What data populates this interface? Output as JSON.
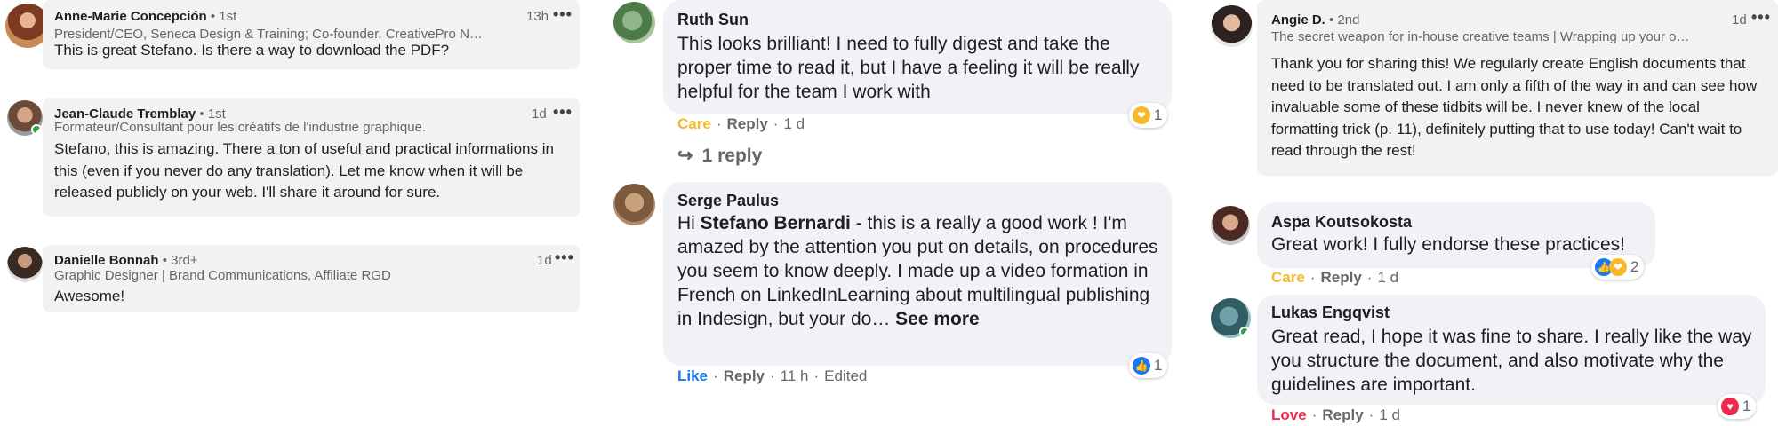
{
  "colors": {
    "linkedin_bubble": "#f2f2f2",
    "facebook_bubble": "#f0f2f5",
    "like_blue": "#1877f2",
    "care_yellow": "#f7b928",
    "love_red": "#f02849",
    "online_green": "#2e9e45"
  },
  "linkedin_comments": [
    {
      "name": "Anne-Marie Concepción",
      "degree": "• 1st",
      "headline": "President/CEO, Seneca Design & Training; Co-founder, CreativePro N…",
      "time": "13h",
      "more": "•••",
      "text": "This is great Stefano. Is there a way to download the PDF?"
    },
    {
      "name": "Jean-Claude Tremblay",
      "degree": "• 1st",
      "headline": "Formateur/Consultant pour les créatifs de l'industrie graphique.",
      "time": "1d",
      "more": "•••",
      "text": "Stefano, this is amazing. There a ton of useful and practical informations in this (even if you never do any translation). Let me know when it will be released publicly on your web. I'll share it around for sure."
    },
    {
      "name": "Danielle Bonnah",
      "degree": "• 3rd+",
      "headline": "Graphic Designer | Brand Communications, Affiliate RGD",
      "time": "1d",
      "more": "•••",
      "text": "Awesome!"
    },
    {
      "name": "Angie D.",
      "degree": "• 2nd",
      "headline": "The secret weapon for in-house creative teams | Wrapping up your o…",
      "time": "1d",
      "more": "•••",
      "text": "Thank you for sharing this! We regularly create English documents that need to be translated out. I am only a fifth of the way in and can see how invaluable some of these tidbits will be. I never knew of the local formatting trick (p. 11), definitely putting that to use today! Can't wait to read through the rest!"
    }
  ],
  "facebook_comments": [
    {
      "name": "Ruth Sun",
      "text": "This looks brilliant! I need to fully digest and take the proper time to read it, but I have a feeling it will be really helpful for the team I work with",
      "action": "Care",
      "reply": "Reply",
      "time": "1 d",
      "reactions": "1",
      "replies_link": "1 reply"
    },
    {
      "name": "Serge Paulus",
      "text_before": "Hi ",
      "mention": "Stefano Bernardi",
      "text_after": " - this is a really a good work ! I'm amazed by the attention you put on details, on procedures you seem to know deeply. I made up a video formation in French on LinkedInLearning about multilingual publishing in Indesign, but your do… ",
      "see_more": "See more",
      "action": "Like",
      "reply": "Reply",
      "time": "11 h",
      "edited": "Edited",
      "reactions": "1"
    },
    {
      "name": "Aspa Koutsokosta",
      "text": "Great work! I fully endorse these practices!",
      "action": "Care",
      "reply": "Reply",
      "time": "1 d",
      "reactions": "2"
    },
    {
      "name": "Lukas Engqvist",
      "text": "Great read, I hope it was fine to share. I really like the way you structure the document, and also motivate why the guidelines are important.",
      "action": "Love",
      "reply": "Reply",
      "time": "1 d",
      "reactions": "1"
    }
  ],
  "icons": {
    "reply_arrow": "reply-arrow-icon",
    "like": "like-reaction-icon",
    "care": "care-reaction-icon",
    "love": "love-reaction-icon"
  }
}
